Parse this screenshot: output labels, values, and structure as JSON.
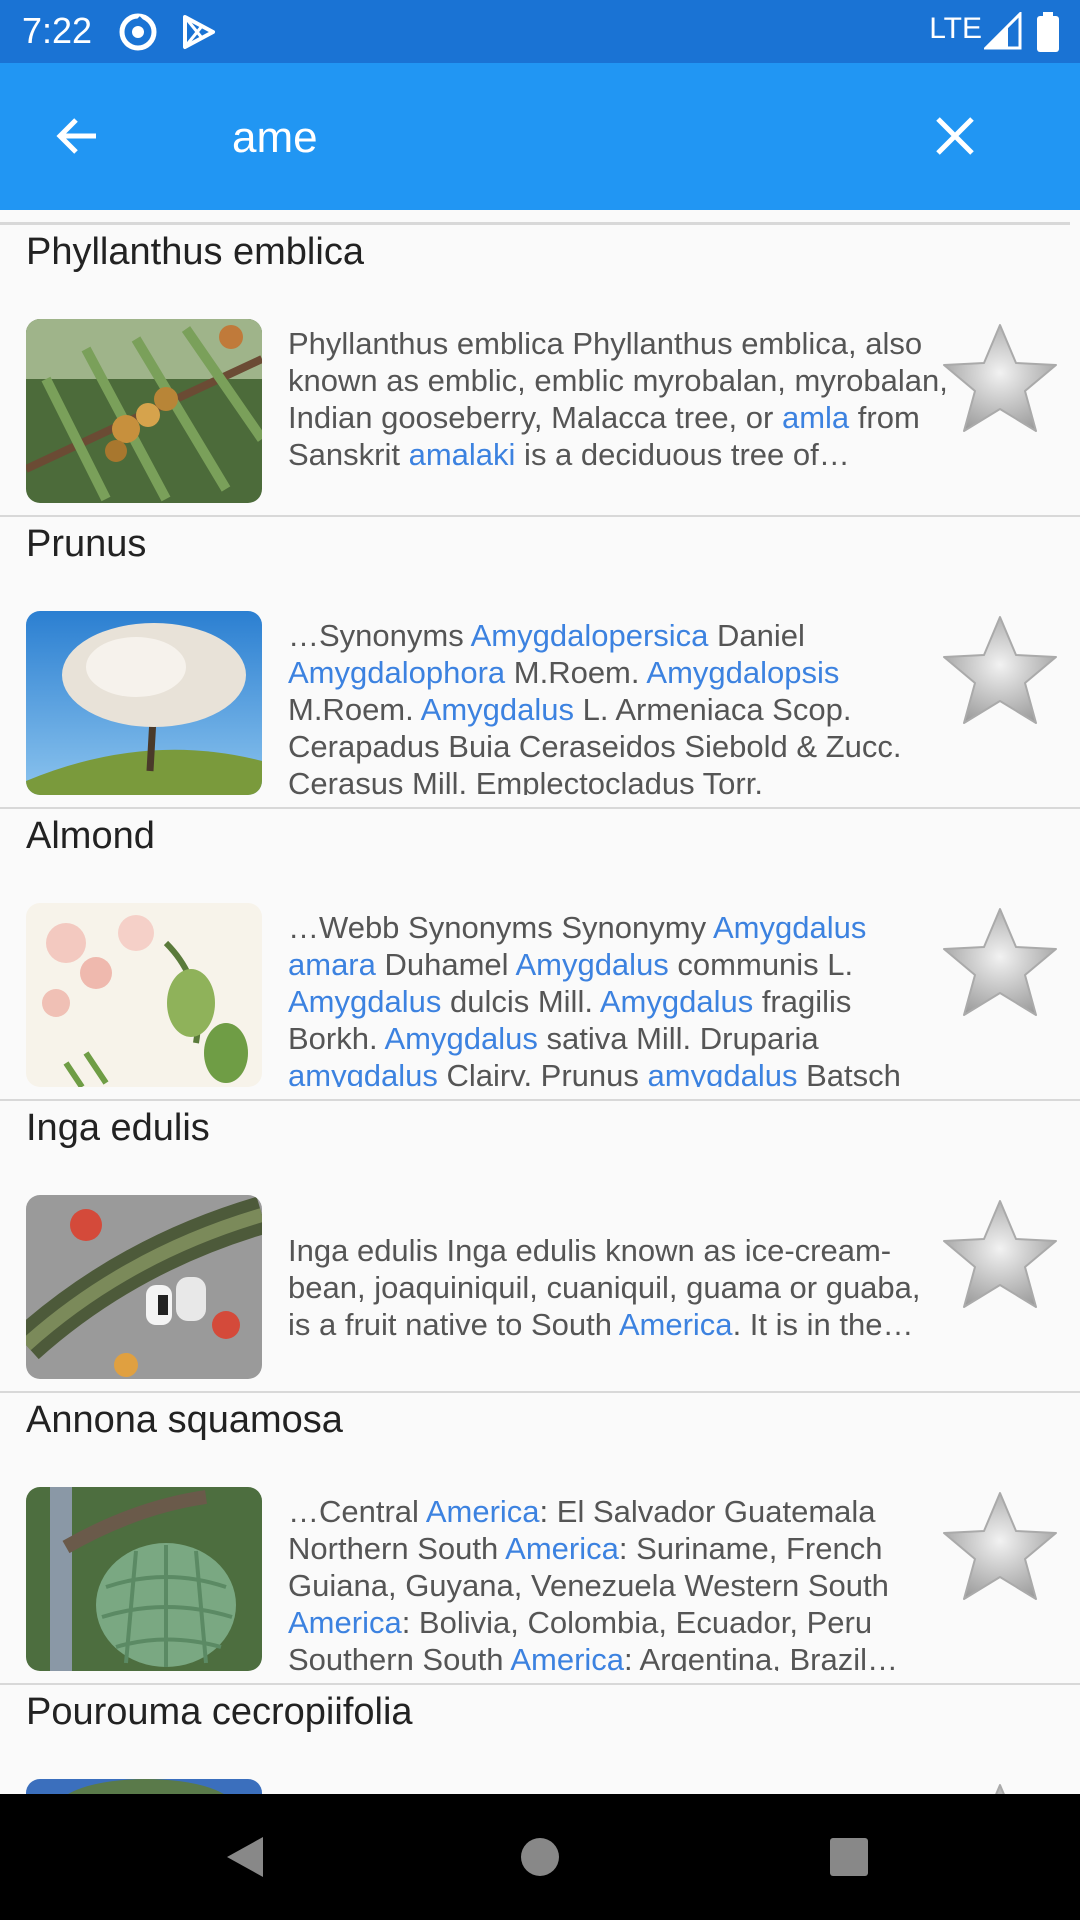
{
  "status": {
    "time": "7:22",
    "network": "LTE"
  },
  "search": {
    "query": "ame"
  },
  "results": [
    {
      "title": "Phyllanthus emblica",
      "segments": [
        {
          "t": "Phyllanthus emblica Phyllanthus emblica, also known as emblic, emblic myrobalan, myrobalan, Indian gooseberry, Malacca tree, or ",
          "h": false
        },
        {
          "t": "amla",
          "h": true
        },
        {
          "t": " from Sanskrit ",
          "h": false
        },
        {
          "t": "amalaki",
          "h": true
        },
        {
          "t": " is a deciduous tree of…",
          "h": false
        }
      ]
    },
    {
      "title": "Prunus",
      "segments": [
        {
          "t": "…Synonyms ",
          "h": false
        },
        {
          "t": "Amygdalopersica",
          "h": true
        },
        {
          "t": " Daniel ",
          "h": false
        },
        {
          "t": "Amygdalophora",
          "h": true
        },
        {
          "t": " M.Roem. ",
          "h": false
        },
        {
          "t": "Amygdalopsis",
          "h": true
        },
        {
          "t": " M.Roem. ",
          "h": false
        },
        {
          "t": "Amygdalus",
          "h": true
        },
        {
          "t": " L. Armeniaca Scop. Cerapadus Buia Ceraseidos Siebold & Zucc. Cerasus Mill. Emplectocladus Torr. Laurocerasus Duhamel",
          "h": false
        }
      ]
    },
    {
      "title": "Almond",
      "segments": [
        {
          "t": "…Webb Synonyms Synonymy ",
          "h": false
        },
        {
          "t": "Amygdalus",
          "h": true
        },
        {
          "t": " ",
          "h": false
        },
        {
          "t": "amara",
          "h": true
        },
        {
          "t": " Duhamel ",
          "h": false
        },
        {
          "t": "Amygdalus",
          "h": true
        },
        {
          "t": " communis L. ",
          "h": false
        },
        {
          "t": "Amygdalus",
          "h": true
        },
        {
          "t": " dulcis Mill. ",
          "h": false
        },
        {
          "t": "Amygdalus",
          "h": true
        },
        {
          "t": " fragilis Borkh. ",
          "h": false
        },
        {
          "t": "Amygdalus",
          "h": true
        },
        {
          "t": " sativa Mill. Druparia ",
          "h": false
        },
        {
          "t": "amygdalus",
          "h": true
        },
        {
          "t": " Clairv. Prunus ",
          "h": false
        },
        {
          "t": "amygdalus",
          "h": true
        },
        {
          "t": " Batsch Prunus",
          "h": false
        }
      ]
    },
    {
      "title": "Inga edulis",
      "center": true,
      "segments": [
        {
          "t": "Inga edulis Inga edulis known as ice-cream-bean, joaquiniquil, cuaniquil, guama or guaba, is a fruit native to South ",
          "h": false
        },
        {
          "t": "America",
          "h": true
        },
        {
          "t": ". It is in the…",
          "h": false
        }
      ]
    },
    {
      "title": "Annona squamosa",
      "segments": [
        {
          "t": "…Central ",
          "h": false
        },
        {
          "t": "America",
          "h": true
        },
        {
          "t": ": El Salvador Guatemala Northern South ",
          "h": false
        },
        {
          "t": "America",
          "h": true
        },
        {
          "t": ": Suriname, French Guiana, Guyana, Venezuela Western South ",
          "h": false
        },
        {
          "t": "America",
          "h": true
        },
        {
          "t": ": Bolivia, Colombia, Ecuador, Peru Southern South ",
          "h": false
        },
        {
          "t": "America",
          "h": true
        },
        {
          "t": ": Argentina, Brazil…",
          "h": false
        }
      ]
    },
    {
      "title": "Pourouma cecropiifolia",
      "segments": []
    }
  ],
  "colors": {
    "status_bar": "#1a73d4",
    "app_bar": "#2196f3",
    "highlight": "#3c82e0"
  }
}
